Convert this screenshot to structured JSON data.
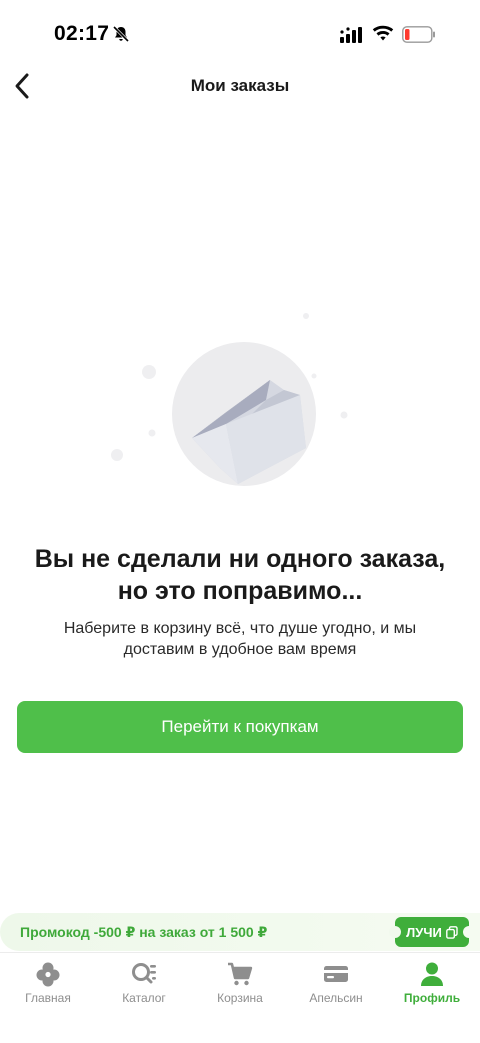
{
  "status_bar": {
    "time": "02:17"
  },
  "header": {
    "title": "Мои заказы"
  },
  "empty_state": {
    "heading": "Вы не сделали ни одного заказа, но это поправимо...",
    "subtext": "Наберите в корзину всё, что душе угодно, и мы доставим в удобное вам время",
    "cta_label": "Перейти к покупкам"
  },
  "promo": {
    "text": "Промокод -500 ₽ на заказ от 1 500 ₽",
    "code": "ЛУЧИ"
  },
  "tabs": [
    {
      "label": "Главная",
      "icon": "home-icon",
      "active": false
    },
    {
      "label": "Каталог",
      "icon": "catalog-icon",
      "active": false
    },
    {
      "label": "Корзина",
      "icon": "cart-icon",
      "active": false
    },
    {
      "label": "Апельсин",
      "icon": "card-icon",
      "active": false
    },
    {
      "label": "Профиль",
      "icon": "profile-icon",
      "active": true
    }
  ],
  "colors": {
    "accent": "#4fbf4a",
    "active_tab": "#3fae3b",
    "inactive": "#8e8e8e"
  }
}
